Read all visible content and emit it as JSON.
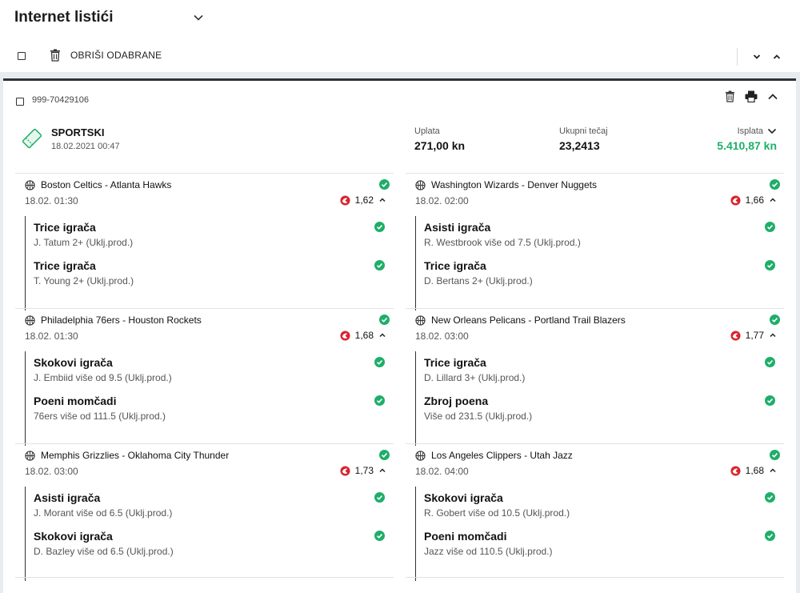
{
  "header": {
    "title": "Internet listići"
  },
  "toolbar": {
    "delete_selected_label": "OBRIŠI ODABRANE"
  },
  "slip": {
    "id": "999-70429106",
    "type": "SPORTSKI",
    "datetime": "18.02.2021 00:47",
    "stake_label": "Uplata",
    "stake_value": "271,00 kn",
    "total_odds_label": "Ukupni tečaj",
    "total_odds_value": "23,2413",
    "payout_label": "Isplata",
    "payout_value": "5.410,87 kn",
    "colors": {
      "win": "#1fae6a",
      "sport_icon": "#d9232d",
      "accent": "#2c3338"
    },
    "events": [
      {
        "match": "Boston Celtics - Atlanta Hawks",
        "time": "18.02. 01:30",
        "odds": "1,62",
        "bets": [
          {
            "market": "Trice igrača",
            "pick": "J. Tatum 2+ (Uklj.prod.)"
          },
          {
            "market": "Trice igrača",
            "pick": "T. Young 2+ (Uklj.prod.)"
          }
        ]
      },
      {
        "match": "Washington Wizards - Denver Nuggets",
        "time": "18.02. 02:00",
        "odds": "1,66",
        "bets": [
          {
            "market": "Asisti igrača",
            "pick": "R. Westbrook više od 7.5 (Uklj.prod.)"
          },
          {
            "market": "Trice igrača",
            "pick": "D. Bertans 2+ (Uklj.prod.)"
          }
        ]
      },
      {
        "match": "Philadelphia 76ers - Houston Rockets",
        "time": "18.02. 01:30",
        "odds": "1,68",
        "bets": [
          {
            "market": "Skokovi igrača",
            "pick": "J. Embiid više od 9.5 (Uklj.prod.)"
          },
          {
            "market": "Poeni momčadi",
            "pick": "76ers više od 111.5 (Uklj.prod.)"
          }
        ]
      },
      {
        "match": "New Orleans Pelicans - Portland Trail Blazers",
        "time": "18.02. 03:00",
        "odds": "1,77",
        "bets": [
          {
            "market": "Trice igrača",
            "pick": "D. Lillard 3+ (Uklj.prod.)"
          },
          {
            "market": "Zbroj poena",
            "pick": "Više od 231.5 (Uklj.prod.)"
          }
        ]
      },
      {
        "match": "Memphis Grizzlies - Oklahoma City Thunder",
        "time": "18.02. 03:00",
        "odds": "1,73",
        "bets": [
          {
            "market": "Asisti igrača",
            "pick": "J. Morant više od 6.5 (Uklj.prod.)"
          },
          {
            "market": "Skokovi igrača",
            "pick": "D. Bazley više od 6.5 (Uklj.prod.)"
          }
        ]
      },
      {
        "match": "Los Angeles Clippers - Utah Jazz",
        "time": "18.02. 04:00",
        "odds": "1,68",
        "bets": [
          {
            "market": "Skokovi igrača",
            "pick": "R. Gobert više od 10.5 (Uklj.prod.)"
          },
          {
            "market": "Poeni momčadi",
            "pick": "Jazz više od 110.5 (Uklj.prod.)"
          }
        ]
      }
    ]
  }
}
